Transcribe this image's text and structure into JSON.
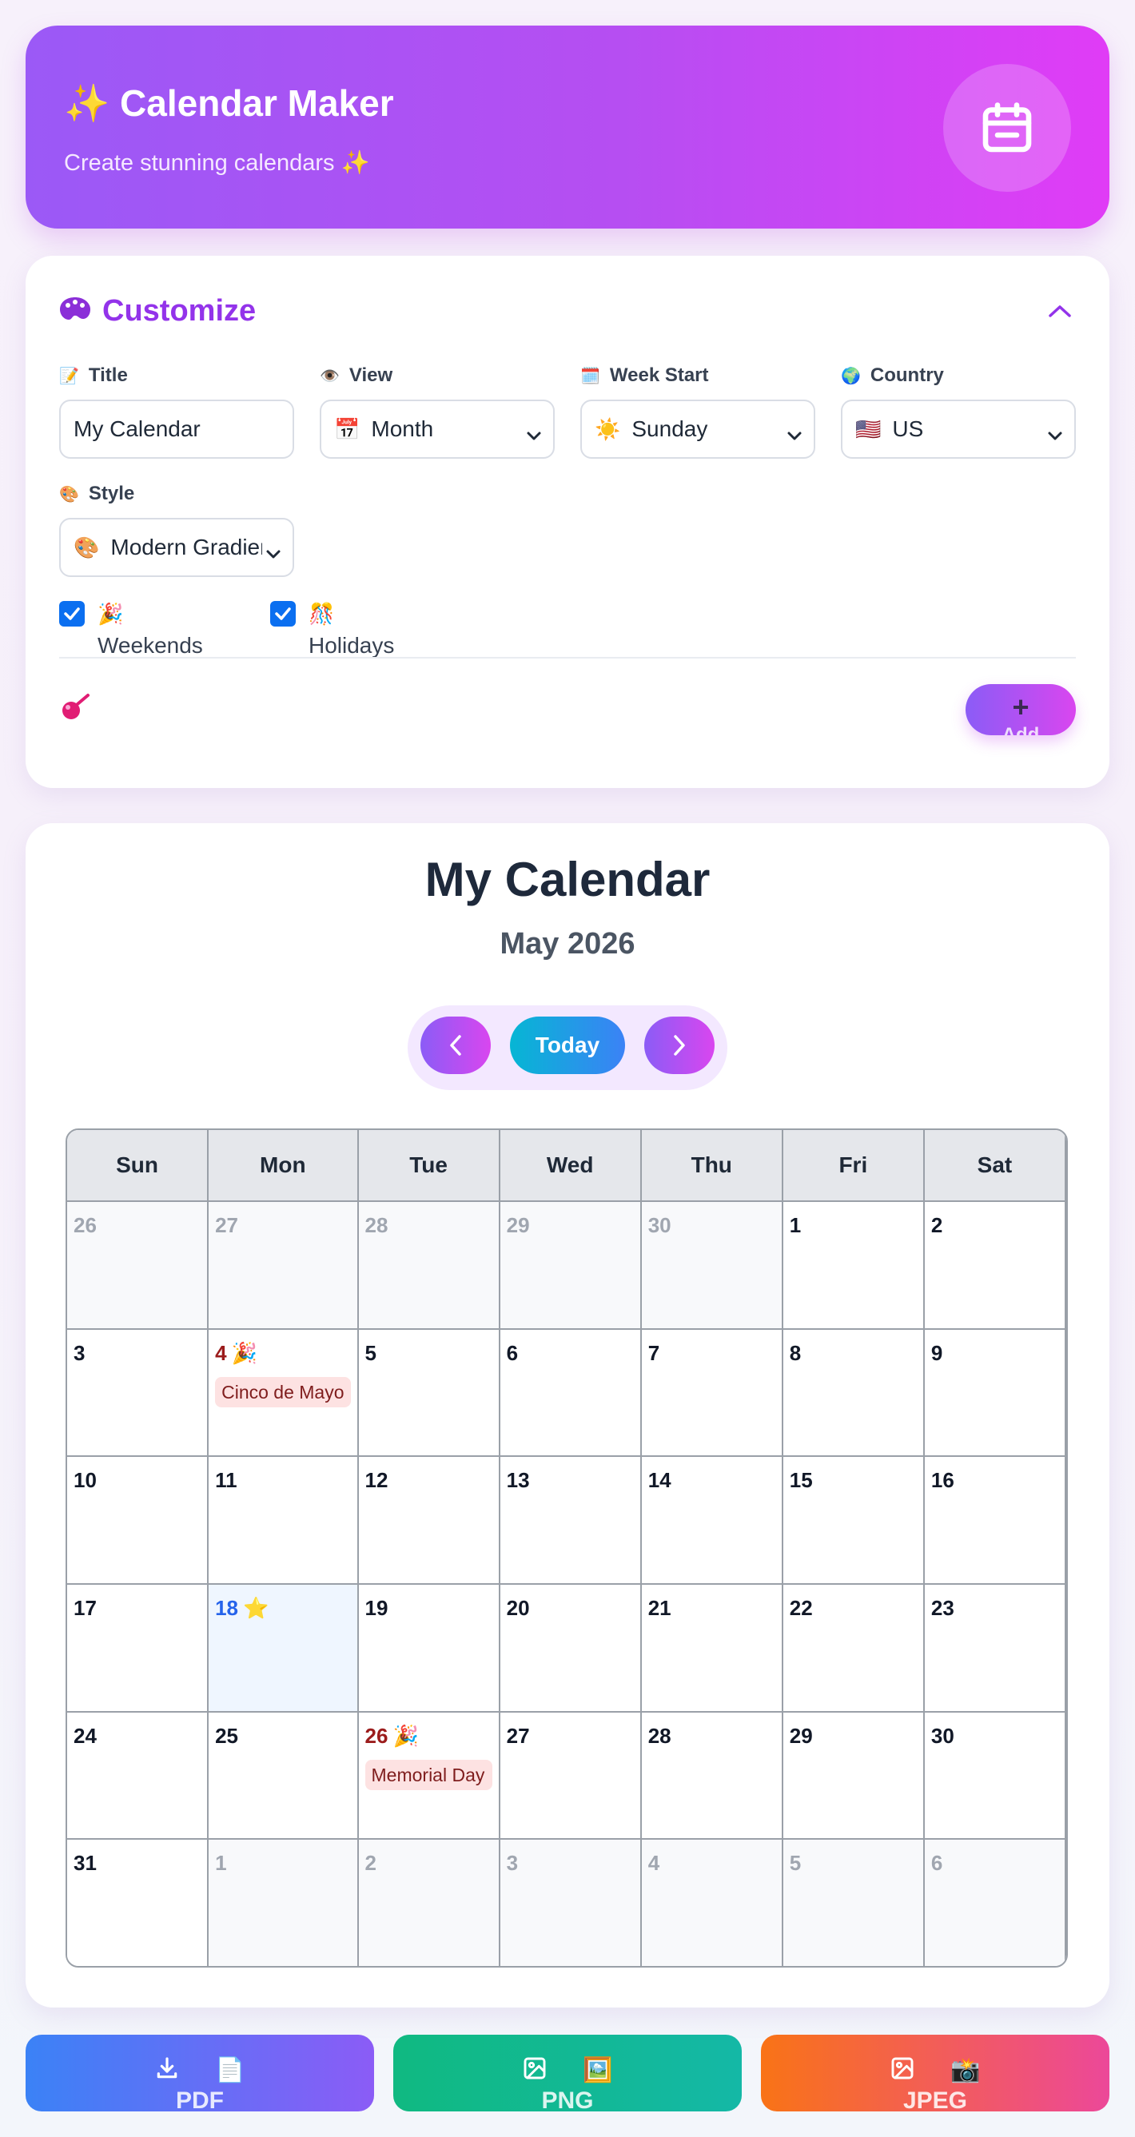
{
  "header": {
    "title": "✨ Calendar Maker",
    "subtitle": "Create stunning calendars ✨"
  },
  "customize": {
    "title": "Customize",
    "fields": {
      "title": {
        "label": "Title",
        "icon": "📝",
        "value": "My Calendar"
      },
      "view": {
        "label": "View",
        "icon": "👁️",
        "value_icon": "📅",
        "value": "Month"
      },
      "week_start": {
        "label": "Week Start",
        "icon": "🗓️",
        "value_icon": "☀️",
        "value": "Sunday"
      },
      "country": {
        "label": "Country",
        "icon": "🌍",
        "value_icon": "🇺🇸",
        "value": "US"
      },
      "style": {
        "label": "Style",
        "icon": "🎨",
        "value_icon": "🎨",
        "value": "Modern Gradient"
      }
    },
    "checks": {
      "weekends": {
        "icon": "🎉",
        "label": "Weekends",
        "checked": true
      },
      "holidays": {
        "icon": "🎊",
        "label": "Holidays",
        "checked": true
      }
    },
    "add_button": {
      "icon": "+",
      "label": "Add"
    }
  },
  "calendar": {
    "title": "My Calendar",
    "month": "May 2026",
    "today_label": "Today",
    "weekdays": [
      "Sun",
      "Mon",
      "Tue",
      "Wed",
      "Thu",
      "Fri",
      "Sat"
    ],
    "days": [
      {
        "n": "26",
        "other": true
      },
      {
        "n": "27",
        "other": true
      },
      {
        "n": "28",
        "other": true
      },
      {
        "n": "29",
        "other": true
      },
      {
        "n": "30",
        "other": true
      },
      {
        "n": "1"
      },
      {
        "n": "2"
      },
      {
        "n": "3"
      },
      {
        "n": "4",
        "holiday": true,
        "emoji": "🎉",
        "event": "Cinco de Mayo"
      },
      {
        "n": "5"
      },
      {
        "n": "6"
      },
      {
        "n": "7"
      },
      {
        "n": "8"
      },
      {
        "n": "9"
      },
      {
        "n": "10"
      },
      {
        "n": "11"
      },
      {
        "n": "12"
      },
      {
        "n": "13"
      },
      {
        "n": "14"
      },
      {
        "n": "15"
      },
      {
        "n": "16"
      },
      {
        "n": "17"
      },
      {
        "n": "18",
        "today": true,
        "emoji": "⭐"
      },
      {
        "n": "19"
      },
      {
        "n": "20"
      },
      {
        "n": "21"
      },
      {
        "n": "22"
      },
      {
        "n": "23"
      },
      {
        "n": "24"
      },
      {
        "n": "25"
      },
      {
        "n": "26",
        "holiday": true,
        "emoji": "🎉",
        "event": "Memorial Day"
      },
      {
        "n": "27"
      },
      {
        "n": "28"
      },
      {
        "n": "29"
      },
      {
        "n": "30"
      },
      {
        "n": "31"
      },
      {
        "n": "1",
        "other": true
      },
      {
        "n": "2",
        "other": true
      },
      {
        "n": "3",
        "other": true
      },
      {
        "n": "4",
        "other": true
      },
      {
        "n": "5",
        "other": true
      },
      {
        "n": "6",
        "other": true
      }
    ]
  },
  "export": {
    "pdf": {
      "label": "PDF",
      "icon": "📄"
    },
    "png": {
      "label": "PNG",
      "icon": "🖼️"
    },
    "jpeg": {
      "label": "JPEG",
      "icon": "📸"
    }
  }
}
